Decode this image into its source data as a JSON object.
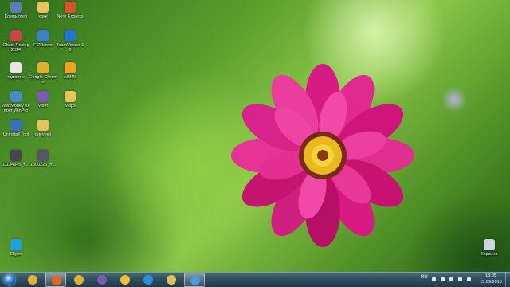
{
  "desktop": {
    "icons": [
      {
        "label": "Компьютер",
        "name": "computer-icon",
        "color": "#5a7fb5"
      },
      {
        "label": "xaxe",
        "name": "folder-icon",
        "color": "#e8c25a"
      },
      {
        "label": "Nero Express",
        "name": "nero-icon",
        "color": "#d9542b"
      },
      {
        "label": "Ghost Racing 2014",
        "name": "ghost-racing-icon",
        "color": "#c44"
      },
      {
        "label": "FSViewer",
        "name": "fsviewer-icon",
        "color": "#3a7fd0"
      },
      {
        "label": "TeamViewer 10",
        "name": "teamviewer-icon",
        "color": "#1f78d1"
      },
      {
        "label": "гаджеты",
        "name": "document-icon",
        "color": "#e6e6e6"
      },
      {
        "label": "Google Chrome",
        "name": "chrome-icon",
        "color": "#e0b22b"
      },
      {
        "label": "AIMP3",
        "name": "aimp-icon",
        "color": "#f0a020"
      },
      {
        "label": "WebMoney Keeper WinPro",
        "name": "webmoney-icon",
        "color": "#4a88c9"
      },
      {
        "label": "Viber",
        "name": "viber-icon",
        "color": "#7d5ab8"
      },
      {
        "label": "Maps",
        "name": "folder-icon",
        "color": "#e8c25a"
      },
      {
        "label": "Uninstall Tool",
        "name": "uninstall-tool-icon",
        "color": "#3a6ec2"
      },
      {
        "label": "рисунки",
        "name": "folder-icon",
        "color": "#e8c25a"
      },
      {
        "label": "11134345_n...",
        "name": "image-file-icon",
        "color": "#445"
      },
      {
        "label": "1300225_n...",
        "name": "image-file-icon",
        "color": "#556"
      },
      {
        "label": "Skype",
        "name": "skype-icon",
        "color": "#1aa3e0"
      },
      {
        "label": "Корзина",
        "name": "recycle-bin-icon",
        "color": "#c9d6df"
      }
    ]
  },
  "taskbar": {
    "pinned": [
      {
        "name": "aimp-icon",
        "color": "#e8b030",
        "active": false
      },
      {
        "name": "firefox-icon",
        "color": "#e2661f",
        "active": true
      },
      {
        "name": "chrome-icon",
        "color": "#e0b22b",
        "active": false
      },
      {
        "name": "viber-icon",
        "color": "#7d5ab8",
        "active": false
      },
      {
        "name": "messenger-icon",
        "color": "#f2c12e",
        "active": false
      },
      {
        "name": "internet-explorer-icon",
        "color": "#2b8fe0",
        "active": false
      },
      {
        "name": "file-explorer-icon",
        "color": "#e6c35a",
        "active": false
      },
      {
        "name": "remote-desktop-icon",
        "color": "#4a9ad9",
        "active": true
      }
    ],
    "tray": {
      "language": "RU",
      "time": "13:05",
      "date": "15.09.2015"
    }
  }
}
